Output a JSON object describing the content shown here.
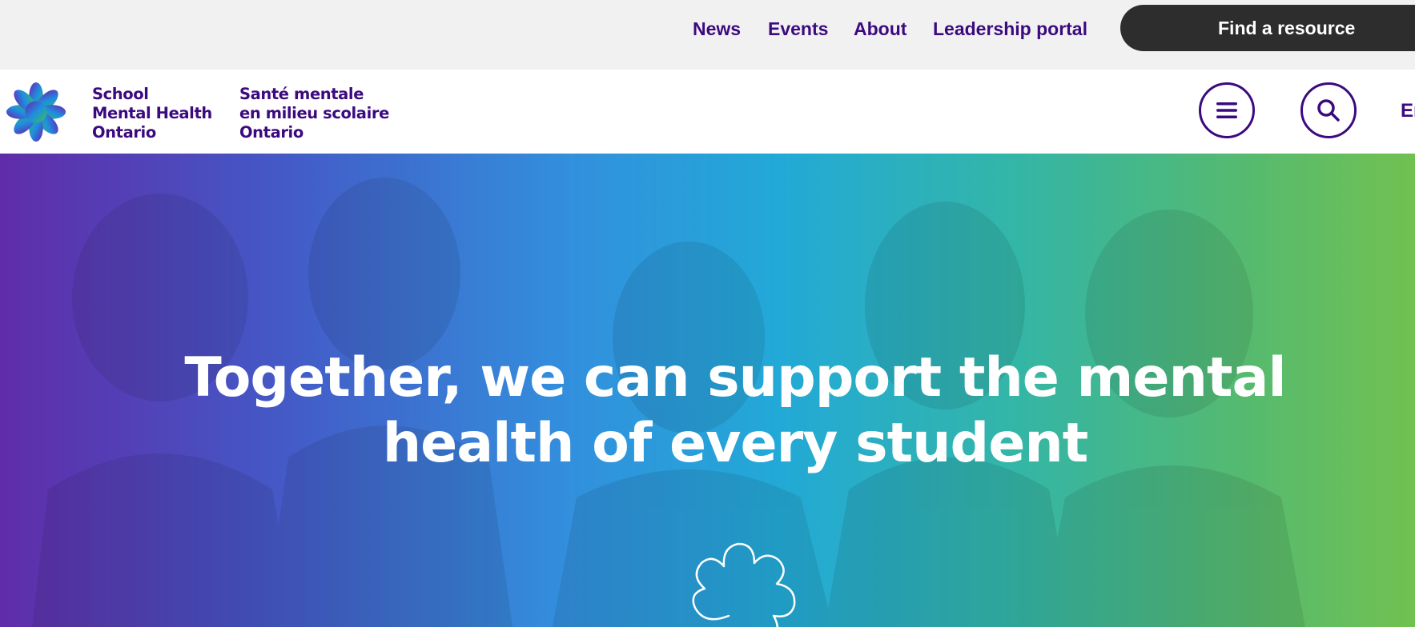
{
  "utility_nav": {
    "links": [
      "News",
      "Events",
      "About",
      "Leadership portal"
    ],
    "cta_label": "Find a resource"
  },
  "header": {
    "logo_en": [
      "School",
      "Mental Health",
      "Ontario"
    ],
    "logo_fr": [
      "Santé mentale",
      "en milieu scolaire",
      "Ontario"
    ],
    "menu_icon": "hamburger-menu-icon",
    "search_icon": "search-icon",
    "language_label": "En"
  },
  "hero": {
    "title_lines": [
      "Together, we can support the mental",
      "health of every student"
    ],
    "decor_icon": "flower-outline-icon"
  },
  "colors": {
    "brand_purple": "#3b0a7f",
    "cta_dark": "#2d2d2d",
    "gradient": [
      "#5a24a6",
      "#2a8bdc",
      "#1aa6d6",
      "#6cbf4a"
    ]
  }
}
